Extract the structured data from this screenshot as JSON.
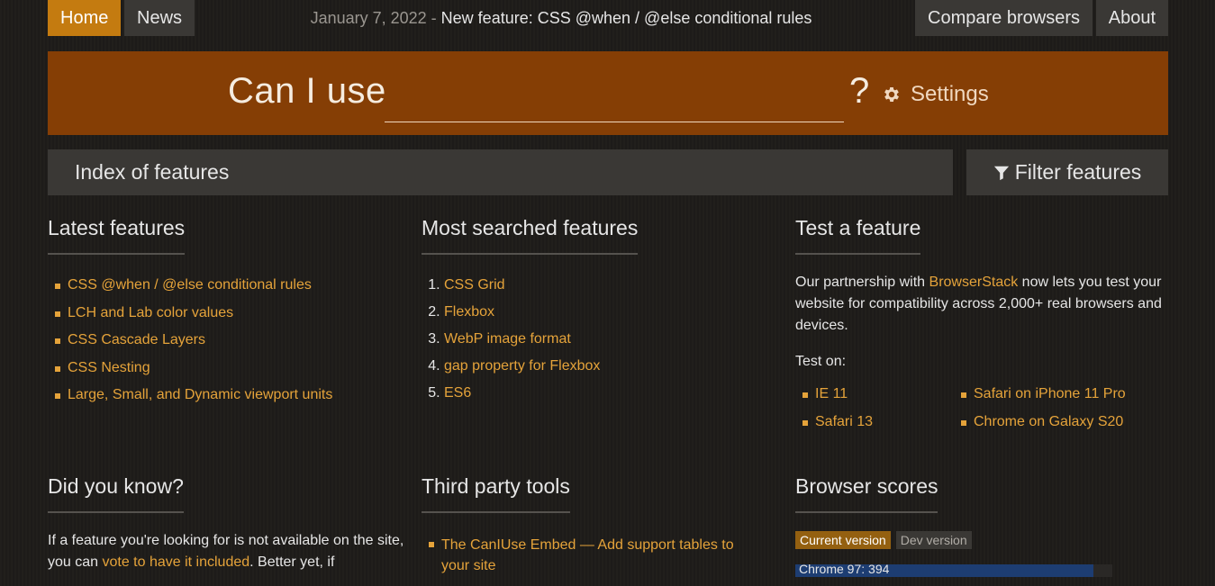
{
  "nav": {
    "left": [
      {
        "label": "Home",
        "active": true
      },
      {
        "label": "News",
        "active": false
      }
    ],
    "right": [
      {
        "label": "Compare browsers"
      },
      {
        "label": "About"
      }
    ],
    "announcement": {
      "date": "January 7, 2022",
      "separator": " - ",
      "text": "New feature: CSS @when / @else conditional rules"
    }
  },
  "search": {
    "prefix": "Can I use",
    "value": "",
    "suffix": "?",
    "settings_label": "Settings",
    "settings_icon": "gear-icon"
  },
  "index": {
    "label": "Index of features",
    "filter_label": "Filter features",
    "filter_icon": "funnel-icon"
  },
  "latest": {
    "title": "Latest features",
    "items": [
      "CSS @when / @else conditional rules",
      "LCH and Lab color values",
      "CSS Cascade Layers",
      "CSS Nesting",
      "Large, Small, and Dynamic viewport units"
    ]
  },
  "most_searched": {
    "title": "Most searched features",
    "items": [
      "CSS Grid",
      "Flexbox",
      "WebP image format",
      "gap property for Flexbox",
      "ES6"
    ]
  },
  "test": {
    "title": "Test a feature",
    "text_before": "Our partnership with ",
    "link": "BrowserStack",
    "text_after": " now lets you test your website for compatibility across 2,000+ real browsers and devices.",
    "test_on": "Test on:",
    "col1": [
      "IE 11",
      "Safari 13"
    ],
    "col2": [
      "Safari on iPhone 11 Pro",
      "Chrome on Galaxy S20"
    ]
  },
  "did_you_know": {
    "title": "Did you know?",
    "text1": "If a feature you're looking for is not available on the site, you can ",
    "link1": "vote to have it included",
    "text2": ". Better yet, if"
  },
  "third_party": {
    "title": "Third party tools",
    "items": [
      "The CanIUse Embed — Add support tables to your site"
    ]
  },
  "scores": {
    "title": "Browser scores",
    "tab_current": "Current version",
    "tab_dev": "Dev version",
    "first_bar": {
      "label": "Chrome 97: 394",
      "fraction": 0.94
    }
  },
  "colors": {
    "accent": "#e5a33a",
    "banner": "#853e05",
    "active_nav": "#c47b10",
    "panel": "#3a3835",
    "bar": "#1d3d72"
  }
}
